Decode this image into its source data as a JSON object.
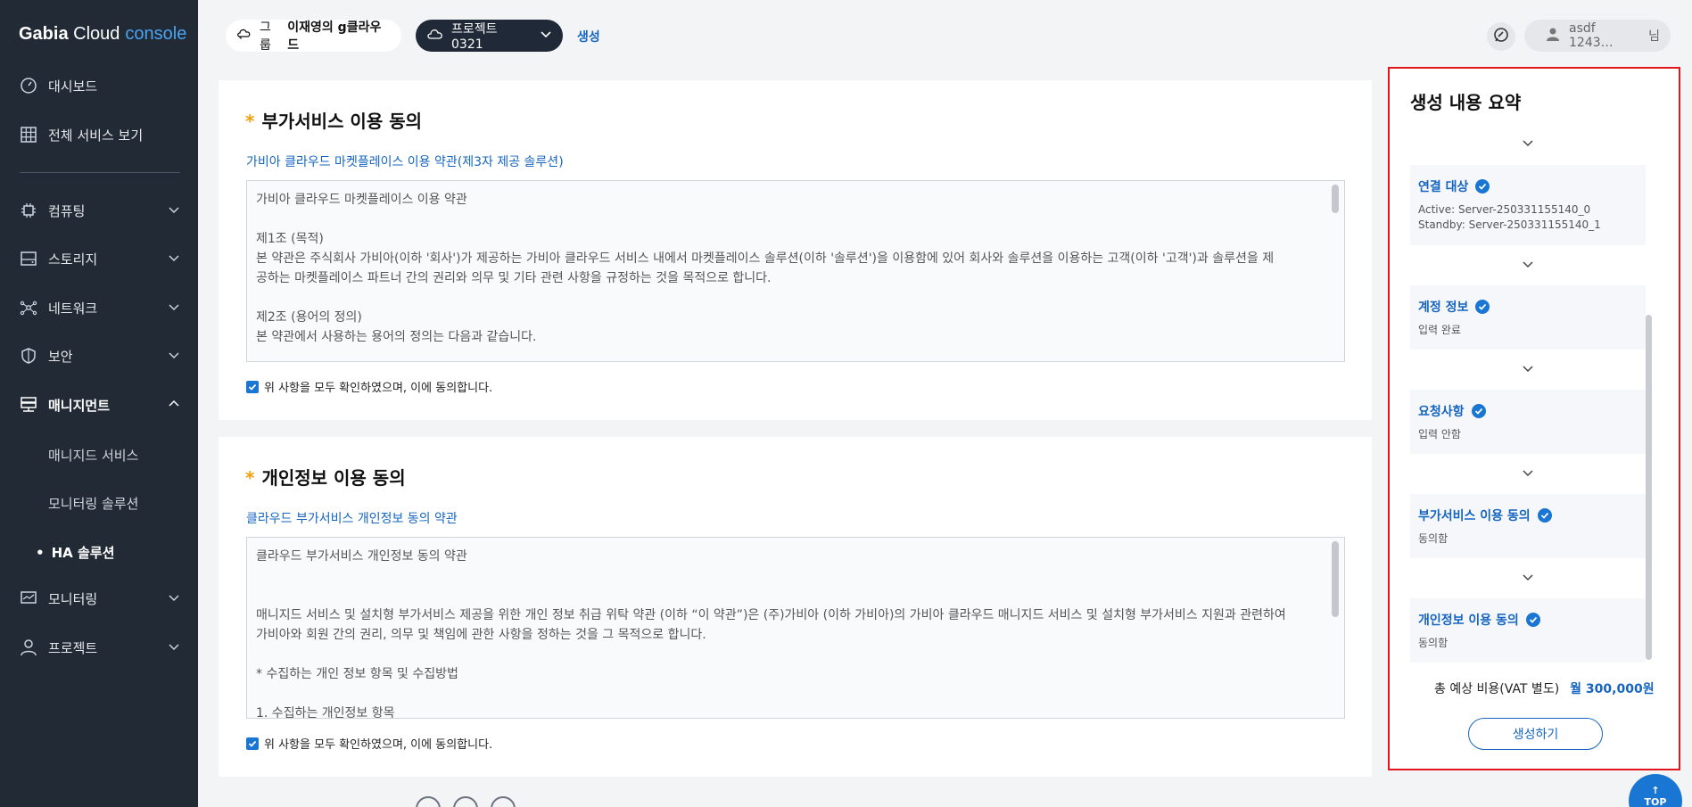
{
  "brand": {
    "name": "Gabia",
    "cloud": "Cloud",
    "console": "console"
  },
  "sidebar": {
    "items": [
      {
        "label": "대시보드",
        "icon": "dashboard-icon"
      },
      {
        "label": "전체 서비스 보기",
        "icon": "grid-icon"
      },
      {
        "label": "컴퓨팅",
        "icon": "chip-icon"
      },
      {
        "label": "스토리지",
        "icon": "storage-icon"
      },
      {
        "label": "네트워크",
        "icon": "network-icon"
      },
      {
        "label": "보안",
        "icon": "shield-icon"
      },
      {
        "label": "매니지먼트",
        "icon": "server-rack-icon"
      },
      {
        "label": "모니터링",
        "icon": "monitor-icon"
      },
      {
        "label": "프로젝트",
        "icon": "user-icon"
      }
    ],
    "sub_items": [
      "매니지드 서비스",
      "모니터링 솔루션",
      "HA 솔루션"
    ]
  },
  "topbar": {
    "group_label": "그룹",
    "group_name": "이재영의 g클라우드",
    "project_name": "프로젝트 0321",
    "create_link": "생성",
    "user_name": "asdf 1243…",
    "user_suffix": "님"
  },
  "card1": {
    "title": "부가서비스 이용 동의",
    "link": "가비아 클라우드 마켓플레이스 이용 약관(제3자 제공 솔루션)",
    "lines": [
      "가비아 클라우드 마켓플레이스 이용 약관",
      "",
      "제1조 (목적)",
      "본 약관은 주식회사 가비아(이하 '회사')가 제공하는 가비아 클라우드 서비스 내에서 마켓플레이스 솔루션(이하 '솔루션')을 이용함에 있어 회사와 솔루션을 이용하는 고객(이하 '고객')과 솔루션을 제",
      "공하는 마켓플레이스 파트너 간의 권리와 의무 및 기타 관련 사항을 규정하는 것을 목적으로 합니다.",
      "",
      "제2조 (용어의 정의)",
      "본 약관에서 사용하는 용어의 정의는 다음과 같습니다."
    ],
    "agree": "위 사항을 모두 확인하였으며, 이에 동의합니다."
  },
  "card2": {
    "title": "개인정보 이용 동의",
    "link": "클라우드 부가서비스 개인정보 동의 약관",
    "lines": [
      "클라우드 부가서비스 개인정보 동의 약관",
      "",
      "",
      "매니지드 서비스 및 설치형 부가서비스 제공을 위한 개인 정보 취급 위탁 약관 (이하 “이 약관”)은 (주)가비아 (이하 가비아)의 가비아 클라우드 매니지드 서비스 및 설치형 부가서비스 지원과 관련하여",
      "가비아와 회원 간의 권리, 의무 및 책임에 관한 사항을 정하는 것을 그 목적으로 합니다.",
      "",
      "* 수집하는 개인 정보 항목 및 수집방법",
      "",
      "1. 수집하는 개인정보 항목"
    ],
    "agree": "위 사항을 모두 확인하였으며, 이에 동의합니다."
  },
  "summary": {
    "title": "생성 내용 요약",
    "items": [
      {
        "label": "연결 대상",
        "desc": [
          "Active: Server-250331155140_0",
          "Standby: Server-250331155140_1"
        ]
      },
      {
        "label": "계정 정보",
        "desc": [
          "입력 완료"
        ]
      },
      {
        "label": "요청사항",
        "desc": [
          "입력 안함"
        ]
      },
      {
        "label": "부가서비스 이용 동의",
        "desc": [
          "동의함"
        ]
      },
      {
        "label": "개인정보 이용 동의",
        "desc": [
          "동의함"
        ]
      }
    ],
    "total_label": "총 예상 비용(VAT 별도)",
    "total_price": "월 300,000원",
    "create_button": "생성하기"
  },
  "top_button": "TOP",
  "colors": {
    "sidebar_bg": "#222a35",
    "accent": "#1565c0",
    "highlight_border": "#e3161d",
    "required_star": "#f59e0b"
  }
}
